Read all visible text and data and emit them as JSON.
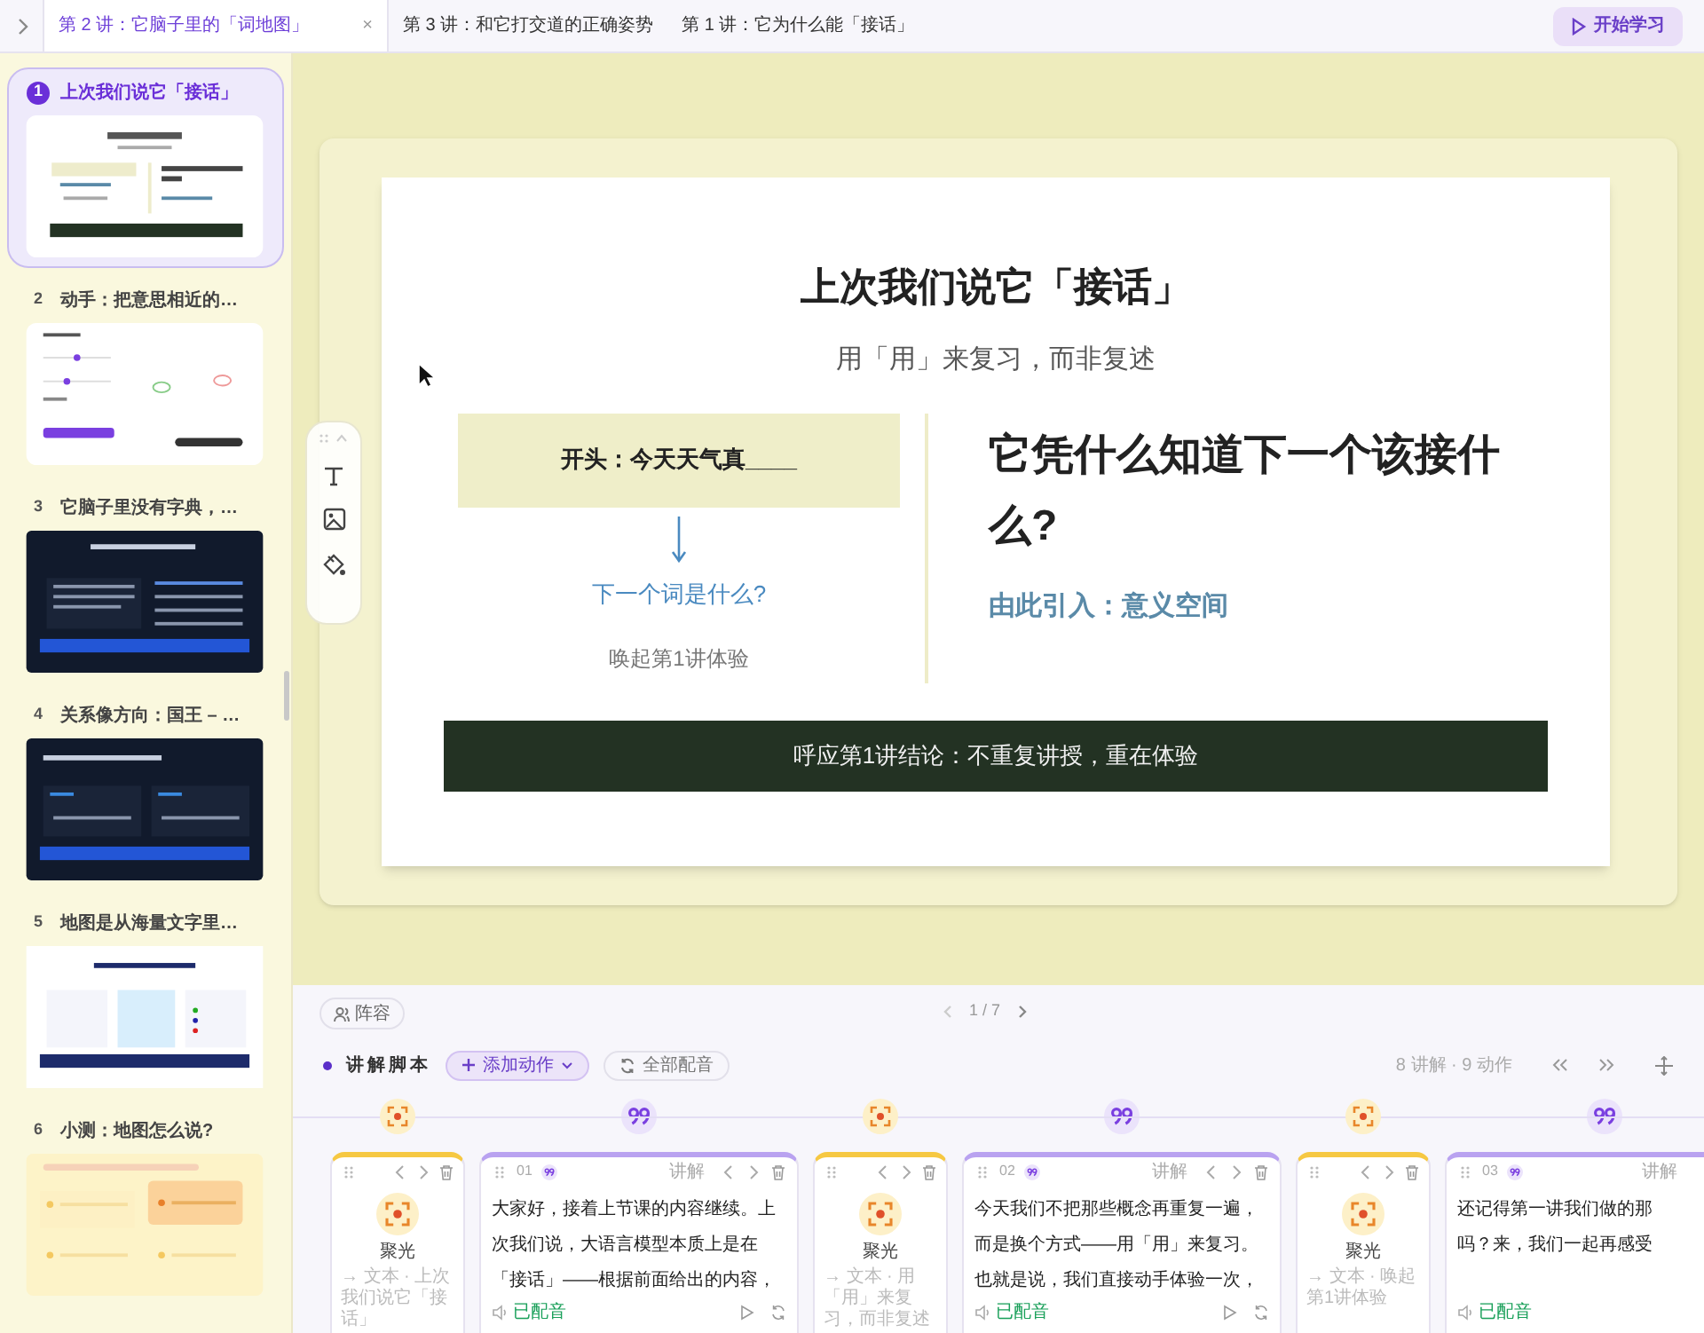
{
  "tabs": [
    {
      "label": "第 2 讲：它脑子里的「词地图」",
      "selected": true,
      "close": "×"
    },
    {
      "label": "第 3 讲：和它打交道的正确姿势",
      "selected": false
    },
    {
      "label": "第 1 讲：它为什么能「接话」",
      "selected": false
    }
  ],
  "start_button": "开始学习",
  "slides": [
    {
      "number": "1",
      "title": "上次我们说它「接话」",
      "selected": true,
      "kind": "recap"
    },
    {
      "number": "2",
      "title": "动手：把意思相近的…",
      "selected": false,
      "kind": "sliders"
    },
    {
      "number": "3",
      "title": "它脑子里没有字典，…",
      "selected": false,
      "kind": "dark-table"
    },
    {
      "number": "4",
      "title": "关系像方向：国王 – …",
      "selected": false,
      "kind": "dark-vectors"
    },
    {
      "number": "5",
      "title": "地图是从海量文字里…",
      "selected": false,
      "kind": "map"
    },
    {
      "number": "6",
      "title": "小测：地图怎么说?",
      "selected": false,
      "kind": "quiz"
    }
  ],
  "slide": {
    "title": "上次我们说它「接话」",
    "subtitle": "用「用」来复习，而非复述",
    "prompt": "开头：今天天气真____",
    "next_question": "下一个词是什么?",
    "recall_note": "唤起第1讲体验",
    "question": "它凭什么知道下一个该接什么?",
    "lead_in": "由此引入：意义空间",
    "banner": "呼应第1讲结论：不重复讲授，重在体验"
  },
  "cast_button": "阵容",
  "page": "1 / 7",
  "script": {
    "title": "讲解脚本",
    "add_action": "添加动作",
    "dub_all": "全部配音",
    "summary": "8 讲解 · 9 动作"
  },
  "cards": [
    {
      "kind": "spotlight",
      "label": "聚光",
      "target": "→ 文本 · 上次我们说它「接话」"
    },
    {
      "kind": "narration",
      "number": "01",
      "tag": "讲解",
      "text": "大家好，接着上节课的内容继续。上次我们说，大语言模型本质上是在「接话」——根据前面给出的内容，",
      "status": "已配音"
    },
    {
      "kind": "spotlight",
      "label": "聚光",
      "target": "→ 文本 · 用「用」来复习，而非复述"
    },
    {
      "kind": "narration",
      "number": "02",
      "tag": "讲解",
      "text": "今天我们不把那些概念再重复一遍，而是换个方式——用「用」来复习。也就是说，我们直接动手体验一次，",
      "status": "已配音"
    },
    {
      "kind": "spotlight",
      "label": "聚光",
      "target": "→ 文本 · 唤起第1讲体验"
    },
    {
      "kind": "narration",
      "number": "03",
      "tag": "讲解",
      "text": "还记得第一讲我们做的那吗？来，我们一起再感受",
      "status": "已配音"
    }
  ]
}
